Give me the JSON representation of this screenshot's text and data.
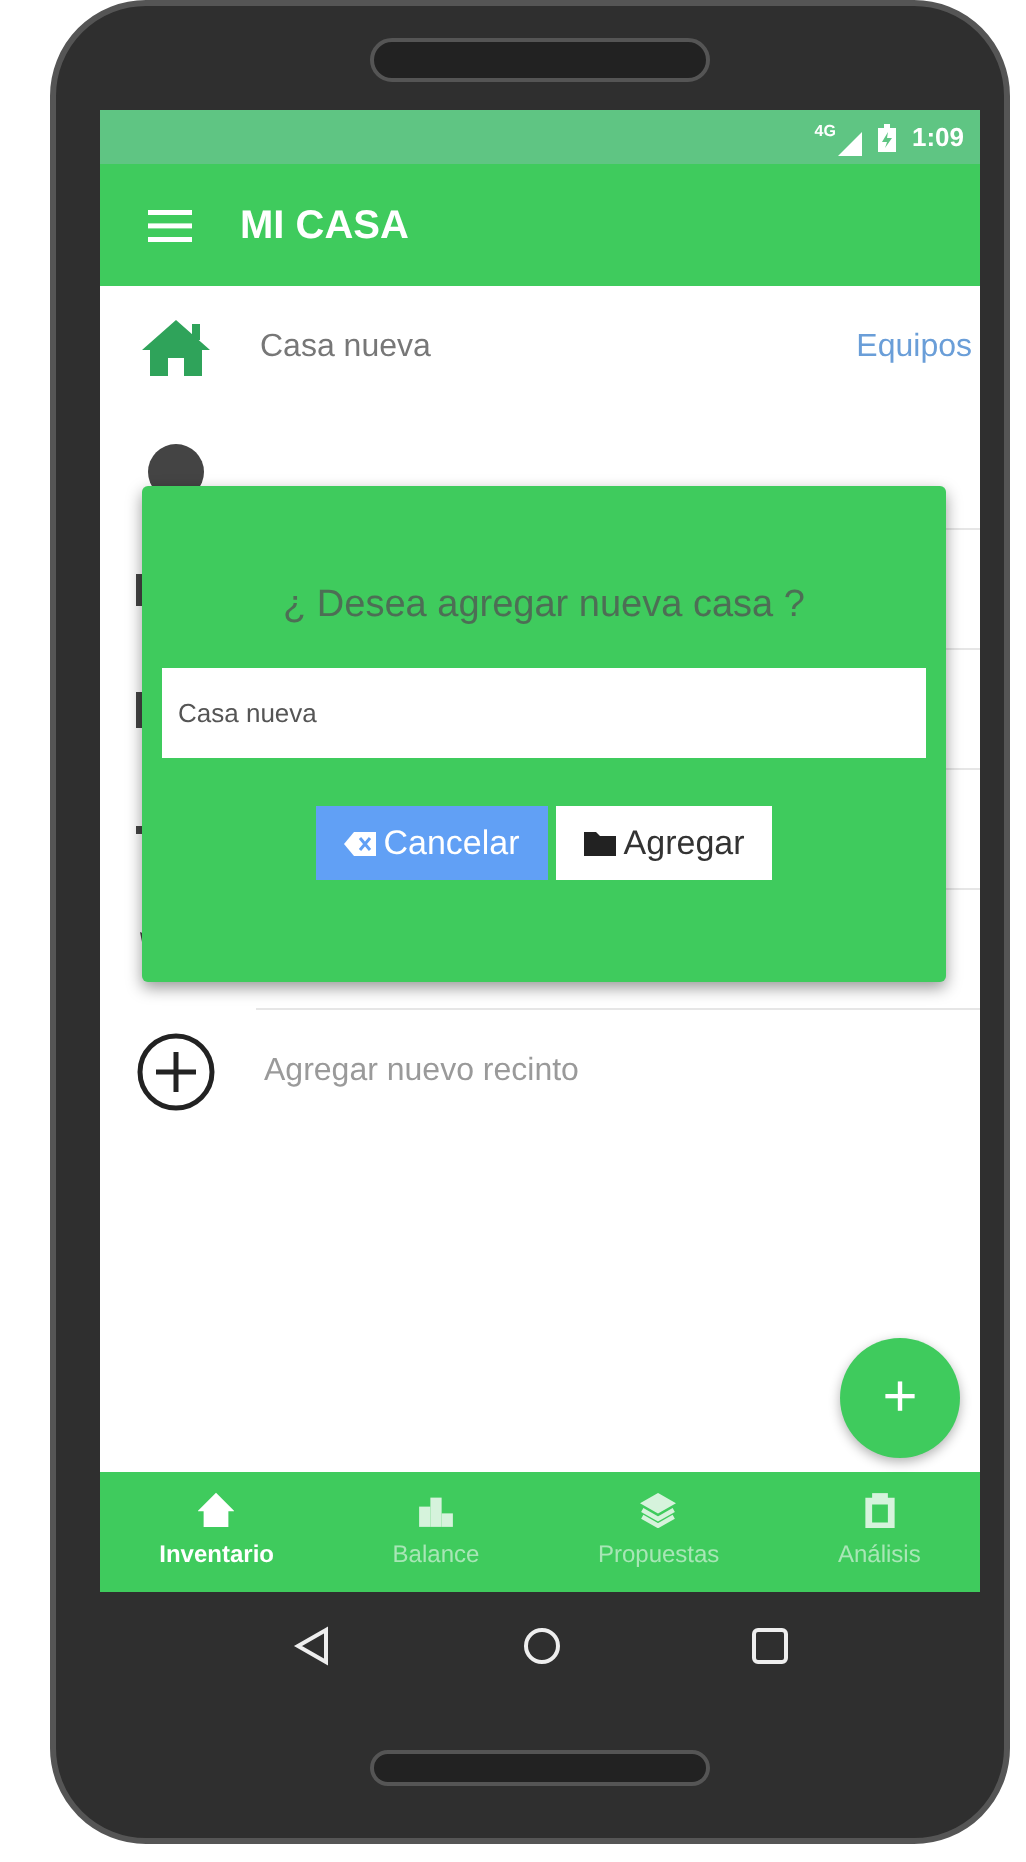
{
  "status_bar": {
    "network": "4G",
    "time": "1:09"
  },
  "app_bar": {
    "title": "MI CASA"
  },
  "house": {
    "name": "Casa nueva",
    "link": "Equipos"
  },
  "add_room": {
    "label": "Agregar nuevo recinto"
  },
  "dialog": {
    "title": "¿ Desea agregar nueva casa ?",
    "field": {
      "value": "Casa nueva"
    },
    "buttons": [
      {
        "kind": "cancel",
        "label": "Cancelar"
      },
      {
        "kind": "confirm",
        "label": "Agregar"
      }
    ]
  },
  "fab": {
    "label": "+"
  },
  "bottom_nav": [
    {
      "kind": "home",
      "label": "Inventario",
      "selected": true
    },
    {
      "kind": "chart",
      "label": "Balance",
      "selected": false
    },
    {
      "kind": "layers",
      "label": "Propuestas",
      "selected": false
    },
    {
      "kind": "clipboard",
      "label": "Análisis",
      "selected": false
    }
  ]
}
